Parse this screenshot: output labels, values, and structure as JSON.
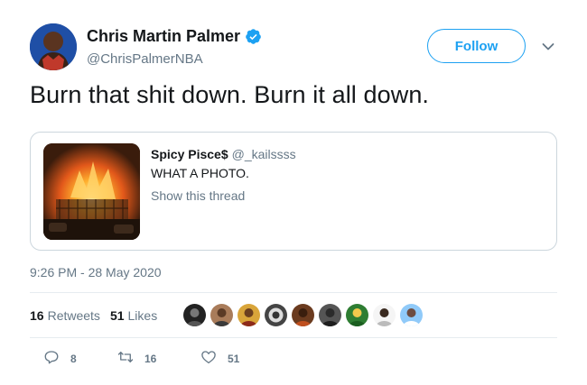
{
  "user": {
    "display_name": "Chris Martin Palmer",
    "handle": "@ChrisPalmerNBA",
    "verified_icon": "verified-badge-icon"
  },
  "follow_label": "Follow",
  "tweet_text": "Burn that shit down. Burn it all down.",
  "quoted": {
    "display_name": "Spicy Pisce$",
    "handle": "@_kailssss",
    "text": "WHAT A PHOTO.",
    "thread_link": "Show this thread"
  },
  "timestamp": "9:26 PM - 28 May 2020",
  "stats": {
    "retweets_count": "16",
    "retweets_label": "Retweets",
    "likes_count": "51",
    "likes_label": "Likes"
  },
  "actions": {
    "reply_count": "8",
    "retweet_count": "16",
    "like_count": "51"
  },
  "colors": {
    "accent": "#1da1f2",
    "text": "#14171a",
    "secondary": "#657786",
    "border": "#ccd6dd"
  }
}
